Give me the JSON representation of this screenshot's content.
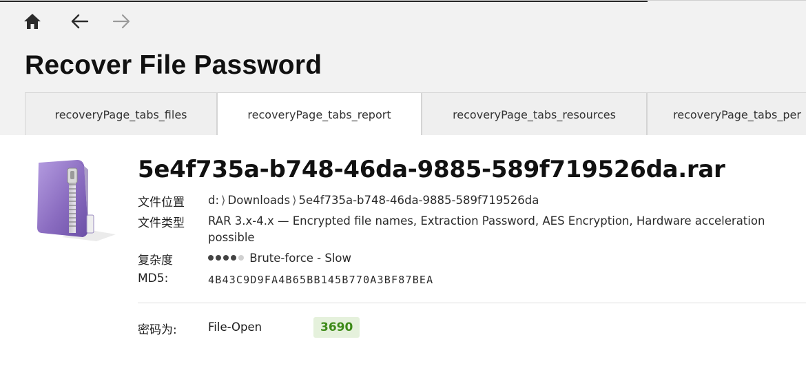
{
  "nav": {
    "home_icon": "home-icon",
    "back_icon": "arrow-left-icon",
    "forward_icon": "arrow-right-icon"
  },
  "page": {
    "title": "Recover File Password"
  },
  "tabs": [
    {
      "label": "recoveryPage_tabs_files",
      "active": false
    },
    {
      "label": "recoveryPage_tabs_report",
      "active": true
    },
    {
      "label": "recoveryPage_tabs_resources",
      "active": false
    },
    {
      "label": "recoveryPage_tabs_per",
      "active": false
    }
  ],
  "file": {
    "icon": "zip-archive-icon",
    "name": "5e4f735a-b748-46da-9885-589f719526da.rar",
    "location_label": "文件位置",
    "location_parts": [
      "d:",
      "Downloads",
      "5e4f735a-b748-46da-9885-589f719526da"
    ],
    "location_separator": "⟩",
    "type_label": "文件类型",
    "type_value": "RAR 3.x-4.x — Encrypted file names, Extraction Password, AES Encryption, Hardware acceleration possible",
    "complexity_label": "复杂度",
    "complexity_level": 4,
    "complexity_max": 5,
    "complexity_text": "Brute-force - Slow",
    "md5_label": "MD5:",
    "md5_value": "4B43C9D9FA4B65BB145B770A3BF87BEA"
  },
  "password": {
    "label": "密码为:",
    "type": "File-Open",
    "value": "3690"
  },
  "colors": {
    "badge_bg": "#e5f1dc",
    "badge_text": "#3d8a18",
    "zip_purple": "#8a6cc0"
  }
}
